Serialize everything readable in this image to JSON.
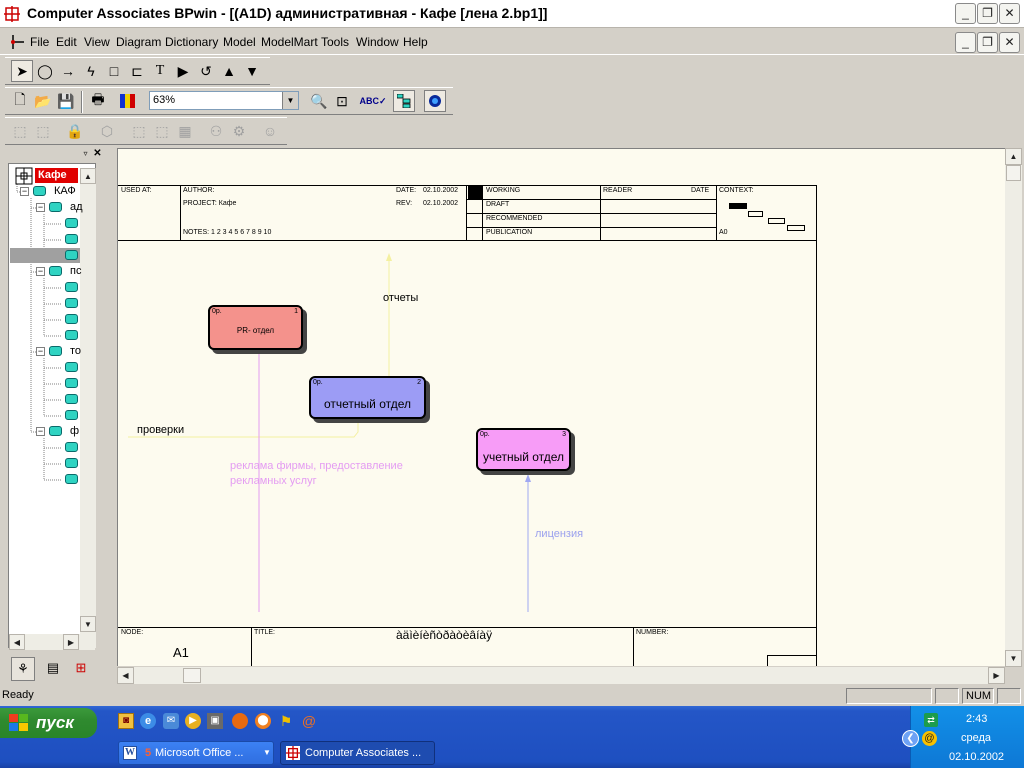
{
  "window": {
    "title": "Computer Associates BPwin - [(A1D) административная - Кафе  [лена 2.bp1]]"
  },
  "menu": [
    "File",
    "Edit",
    "View",
    "Diagram",
    "Dictionary",
    "Model",
    "ModelMart",
    "Tools",
    "Window",
    "Help"
  ],
  "toolbar": {
    "zoom_value": "63%"
  },
  "tree": {
    "root_label": "Кафе",
    "model_label": "КАФ",
    "group1": "ад",
    "group2": "пс",
    "group3": "то",
    "group4": "ф"
  },
  "frame": {
    "used_at": "USED AT:",
    "author": "AUTHOR:",
    "project": "PROJECT:  Кафе",
    "date_label": "DATE:",
    "date_value": "02.10.2002",
    "rev_label": "REV:",
    "rev_value": "02.10.2002",
    "notes": "NOTES:  1  2  3  4  5  6  7  8  9  10",
    "working": "WORKING",
    "draft": "DRAFT",
    "recommended": "RECOMMENDED",
    "publication": "PUBLICATION",
    "reader": "READER",
    "reader_date": "DATE",
    "context": "CONTEXT:",
    "context_node": "A0",
    "node_label": "NODE:",
    "node_value": "A1",
    "title_label": "TITLE:",
    "title_value": "àäìèíèñòðàòèâíàÿ",
    "number_label": "NUMBER:"
  },
  "boxes": [
    {
      "label": "PR- отдел",
      "number": "1",
      "cost": "0р.",
      "color": "#f4928c"
    },
    {
      "label": "отчетный отдел",
      "number": "2",
      "cost": "0р.",
      "color": "#9c9cf5"
    },
    {
      "label": "учетный отдел",
      "number": "3",
      "cost": "0р.",
      "color": "#f79cf7"
    }
  ],
  "arrows": {
    "reports": "отчеты",
    "checks": "проверки",
    "advertising_line1": "реклама фирмы, предоставление",
    "advertising_line2": "рекламных услуг",
    "license": "лицензия"
  },
  "status": {
    "text": "Ready",
    "num": "NUM"
  },
  "taskbar": {
    "start": "пуск",
    "tasks": [
      "Microsoft Office ...",
      "Computer Associates ..."
    ],
    "time": "2:43",
    "day": "среда",
    "date": "02.10.2002"
  }
}
